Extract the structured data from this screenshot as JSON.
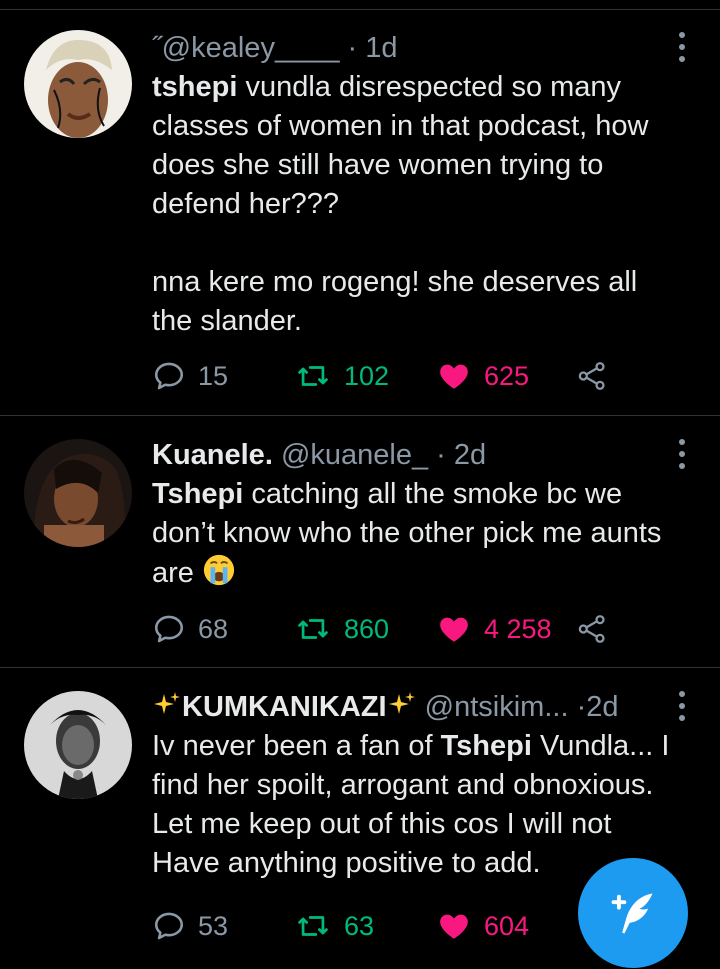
{
  "colors": {
    "background": "#000000",
    "text": "#e7e9ea",
    "secondary": "#8b98a5",
    "retweet": "#00ba7c",
    "like": "#f91880",
    "accent": "#1d9bf0",
    "divider": "#2f3336"
  },
  "tweets": [
    {
      "prefix": "˝",
      "name": "",
      "handle": "@kealey____",
      "separator": "·",
      "time": "1d",
      "text_bold": "tshepi",
      "text_rest": " vundla disrespected so many classes of women in that podcast, how does she still have women trying to defend her???",
      "text_para2": "nna kere mo rogeng! she deserves all the slander.",
      "replies": "15",
      "retweets": "102",
      "likes": "625",
      "liked": true
    },
    {
      "name": "Kuanele.",
      "handle": "@kuanele_",
      "separator": "·",
      "time": "2d",
      "text_bold": "Tshepi",
      "text_rest": " catching all the smoke bc we don’t know who the other pick me aunts are",
      "emoji": "crying-face-emoji",
      "replies": "68",
      "retweets": "860",
      "likes": "4 258",
      "liked": true
    },
    {
      "name": "KUMKANIKAZI",
      "name_decor": "sparkles-emoji",
      "handle": "@ntsikim...",
      "separator": "·",
      "time": "2d",
      "text_pre": "Iv never been a fan of ",
      "text_bold": "Tshepi",
      "text_rest": " Vundla... I find her spoilt, arrogant and obnoxious. Let me keep out of this cos I will not Have anything positive to add.",
      "replies": "53",
      "retweets": "63",
      "likes": "604",
      "liked": true
    }
  ],
  "icons": {
    "reply": "reply-icon",
    "retweet": "retweet-icon",
    "like": "heart-icon",
    "share": "share-icon",
    "more": "more-options-icon",
    "compose": "compose-tweet-icon"
  }
}
